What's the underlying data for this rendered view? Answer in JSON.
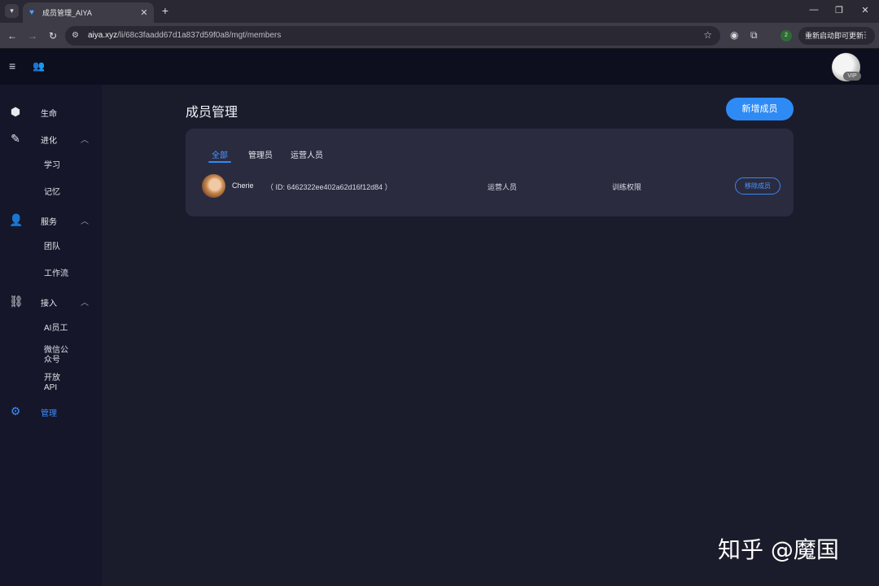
{
  "browser": {
    "tab_title": "成员管理_AIYA",
    "url_host": "aiya.xyz",
    "url_path": "/li/68c3faadd67d1a837d59f0a8/mgt/members",
    "profile_badge": "2",
    "update_label": "重新启动即可更新"
  },
  "header": {
    "vip_label": "VIP"
  },
  "sidebar": {
    "items": [
      {
        "label": "生命"
      },
      {
        "label": "进化",
        "children": [
          "学习",
          "记忆"
        ]
      },
      {
        "label": "服务",
        "children": [
          "团队",
          "工作流"
        ]
      },
      {
        "label": "接入",
        "children": [
          "AI员工",
          "微信公\n众号",
          "开放\nAPI"
        ]
      },
      {
        "label": "管理"
      }
    ]
  },
  "main": {
    "page_title": "成员管理",
    "add_member_label": "新增成员",
    "tabs": [
      {
        "label": "全部",
        "active": true
      },
      {
        "label": "管理员",
        "active": false
      },
      {
        "label": "运营人员",
        "active": false
      }
    ],
    "members": [
      {
        "name": "Cherie",
        "id_text": "（ ID: 6462322ee402a62d16f12d84 ）",
        "role": "运营人员",
        "permission": "训练权限",
        "action_label": "移除成员"
      }
    ]
  },
  "watermark": "知乎 @魔国",
  "colors": {
    "accent": "#2e8bf5",
    "sidebar_bg": "#151629",
    "header_bg": "#0d0f1e",
    "content_bg": "#1b1c2b",
    "card_bg": "#2a2b3f"
  }
}
